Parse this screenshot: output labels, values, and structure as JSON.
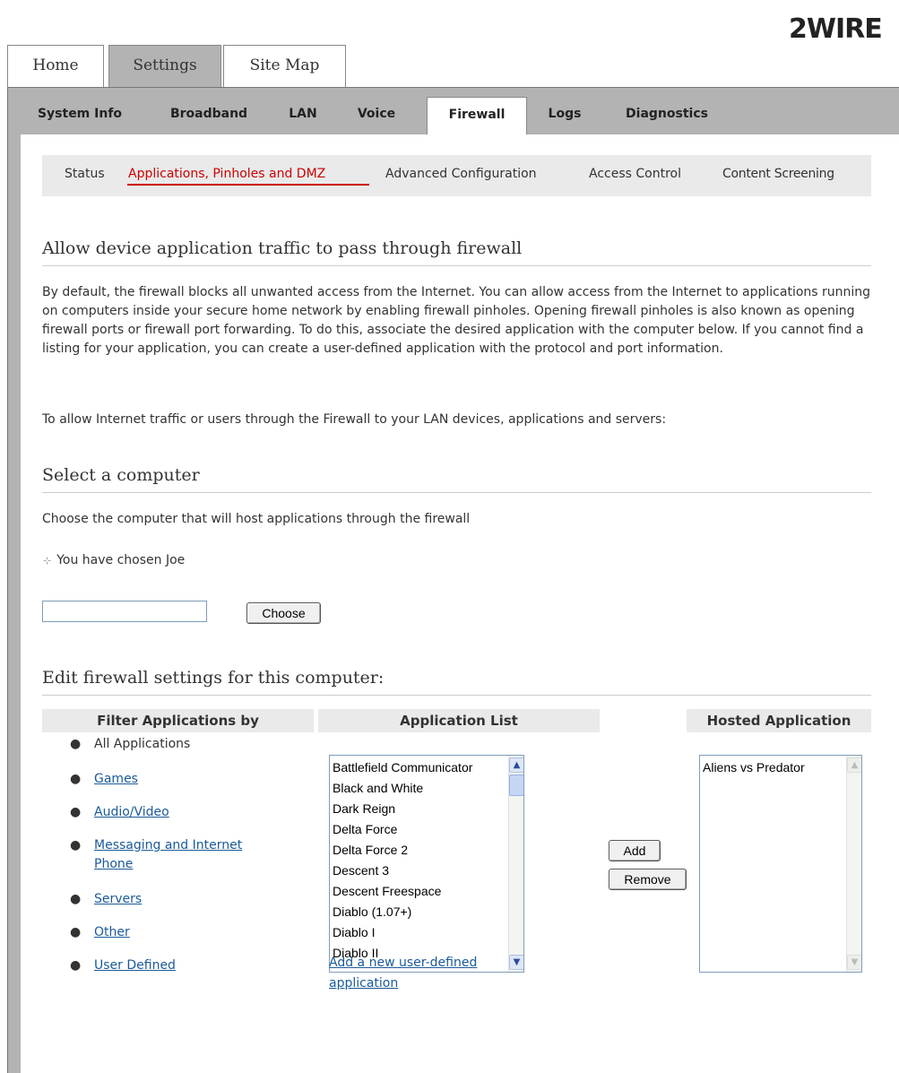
{
  "brand": {
    "logo_text": "2WIRE"
  },
  "top_tabs": [
    {
      "label": "Home"
    },
    {
      "label": "Settings",
      "active": true
    },
    {
      "label": "Site Map"
    }
  ],
  "sub_tabs": [
    {
      "label": "System Info"
    },
    {
      "label": "Broadband"
    },
    {
      "label": "LAN"
    },
    {
      "label": "Voice"
    },
    {
      "label": "Firewall",
      "active": true
    },
    {
      "label": "Logs"
    },
    {
      "label": "Diagnostics"
    }
  ],
  "firewall_nav": [
    {
      "label": "Status"
    },
    {
      "label": "Applications, Pinholes and DMZ",
      "active": true
    },
    {
      "label": "Advanced Configuration"
    },
    {
      "label": "Access Control"
    },
    {
      "label": "Content Screening"
    }
  ],
  "section1": {
    "title": "Allow device application traffic to pass through firewall",
    "intro": "By default, the firewall blocks all unwanted access from the Internet. You can allow access from the Internet to applications running on computers inside your secure home network by enabling firewall pinholes. Opening firewall pinholes is also known as opening firewall ports or firewall port forwarding. To do this, associate the desired application with the computer below. If you cannot find a listing for your application, you can create a user-defined application with the protocol and port information.",
    "instruction": "To allow Internet traffic or users through the Firewall to your LAN devices, applications and servers:"
  },
  "select_computer": {
    "title": "Select a computer",
    "description": "Choose the computer that will host applications through the firewall",
    "chosen_text": "You have chosen Joe",
    "input_value": "",
    "choose_button": "Choose"
  },
  "edit_settings": {
    "title": "Edit firewall settings for this computer:",
    "filter_header": "Filter Applications by",
    "list_header": "Application List",
    "hosted_header": "Hosted Application",
    "filters": [
      {
        "label": "All Applications",
        "link": false
      },
      {
        "label": "Games",
        "link": true
      },
      {
        "label": "Audio/Video",
        "link": true
      },
      {
        "label": "Messaging and Internet Phone",
        "link": true
      },
      {
        "label": "Servers",
        "link": true
      },
      {
        "label": "Other",
        "link": true
      },
      {
        "label": "User Defined",
        "link": true
      }
    ],
    "applications": [
      "Battlefield Communicator",
      "Black and White",
      "Dark Reign",
      "Delta Force",
      "Delta Force 2",
      "Descent 3",
      "Descent Freespace",
      "Diablo (1.07+)",
      "Diablo I",
      "Diablo II"
    ],
    "hosted": [
      "Aliens vs Predator"
    ],
    "add_button": "Add",
    "remove_button": "Remove",
    "add_new_link": "Add a new user-defined application"
  },
  "icons": {
    "chosen": "computer-icon",
    "scroll_up": "chevron-up-icon",
    "scroll_down": "chevron-down-icon"
  }
}
